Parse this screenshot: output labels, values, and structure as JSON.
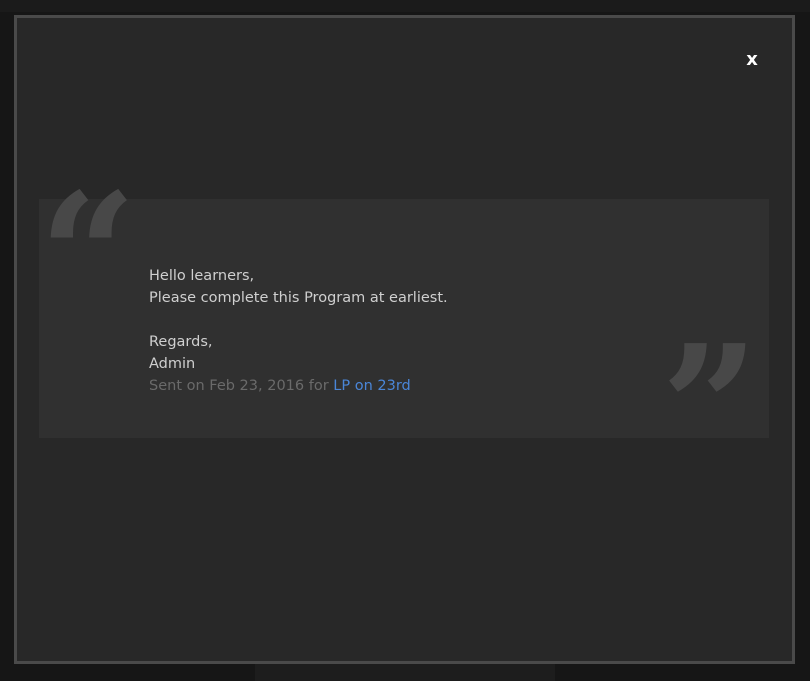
{
  "modal": {
    "close_label": "x"
  },
  "message": {
    "greeting": "Hello learners,",
    "body": "Please complete this Program at earliest.",
    "closing": "Regards,",
    "signature": "Admin",
    "sent_prefix": "Sent on Feb 23, 2016 for ",
    "program_link": "LP on 23rd"
  },
  "icons": {
    "open_quote": "open-quote-icon",
    "close_quote": "close-quote-icon"
  },
  "colors": {
    "link": "#4a86d8",
    "meta_text": "#6a6a6a",
    "modal_bg": "#282828",
    "card_bg": "#303030"
  }
}
